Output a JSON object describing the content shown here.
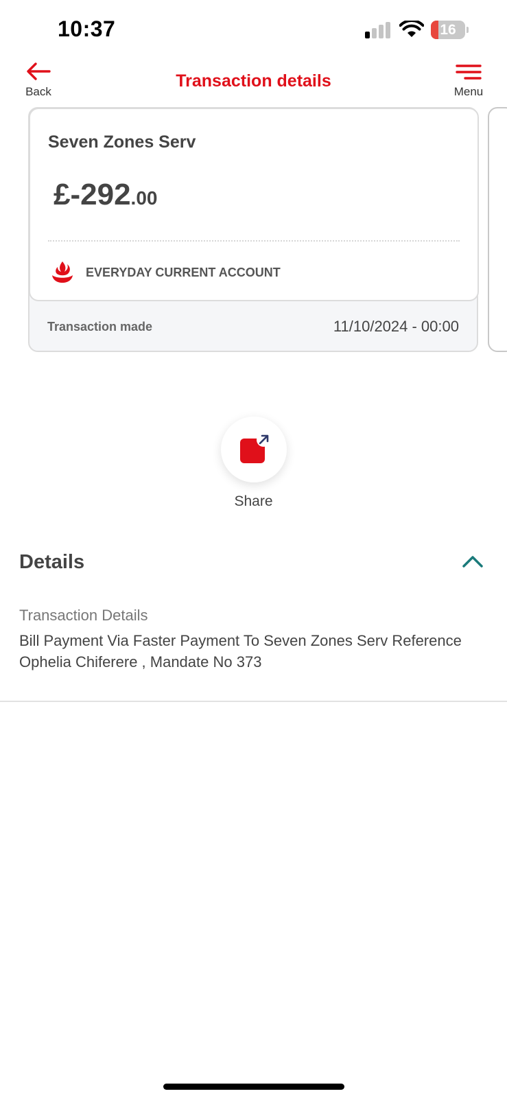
{
  "status_bar": {
    "time": "10:37",
    "battery": "16",
    "battery_level": 0.16
  },
  "header": {
    "back_label": "Back",
    "title": "Transaction details",
    "menu_label": "Menu"
  },
  "transaction": {
    "merchant": "Seven Zones Serv",
    "amount_main": "£-292",
    "amount_pence": ".00",
    "account_name": "EVERYDAY CURRENT ACCOUNT",
    "made_label": "Transaction made",
    "made_value": "11/10/2024 - 00:00"
  },
  "share": {
    "label": "Share"
  },
  "details": {
    "heading": "Details",
    "label": "Transaction Details",
    "value": "Bill Payment Via Faster Payment To Seven Zones Serv Reference Ophelia Chiferere , Mandate No 373"
  },
  "colors": {
    "brand": "#e0101a",
    "toggle": "#1a7a7a",
    "text": "#444444"
  },
  "icons": [
    "back-arrow-icon",
    "menu-icon",
    "bank-flame-icon",
    "share-icon",
    "chevron-up-icon",
    "signal-icon",
    "wifi-icon",
    "battery-icon"
  ]
}
